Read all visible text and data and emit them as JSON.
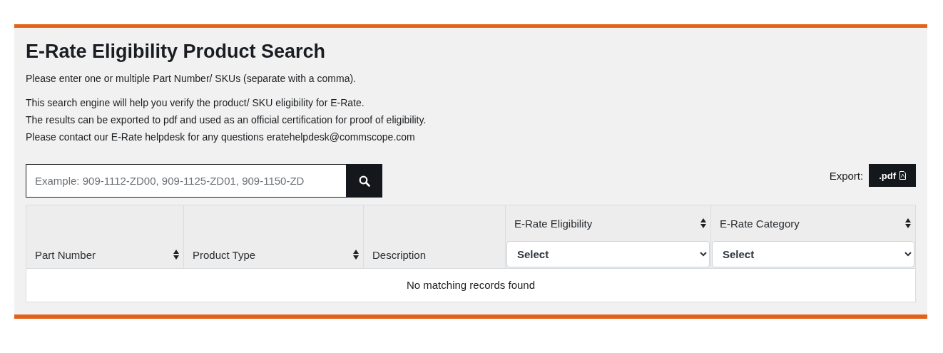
{
  "title": "E-Rate Eligibility Product Search",
  "intro": "Please enter one or multiple Part Number/ SKUs (separate with a comma).",
  "info_lines": [
    "This search engine will help you verify the product/ SKU eligibility for E-Rate.",
    "The results can be exported to pdf and used as an official certification for proof of eligibility.",
    "Please contact our E-Rate helpdesk for any questions eratehelpdesk@commscope.com"
  ],
  "search": {
    "placeholder": "Example: 909-1112-ZD00, 909-1125-ZD01, 909-1150-ZD"
  },
  "export": {
    "label": "Export:",
    "button": ".pdf"
  },
  "table": {
    "columns": [
      {
        "label": "Part Number",
        "sortable": true
      },
      {
        "label": "Product Type",
        "sortable": true
      },
      {
        "label": "Description",
        "sortable": false
      },
      {
        "label": "E-Rate Eligibility",
        "sortable": true,
        "filter": "Select"
      },
      {
        "label": "E-Rate Category",
        "sortable": true,
        "filter": "Select"
      }
    ],
    "empty_message": "No matching records found"
  }
}
